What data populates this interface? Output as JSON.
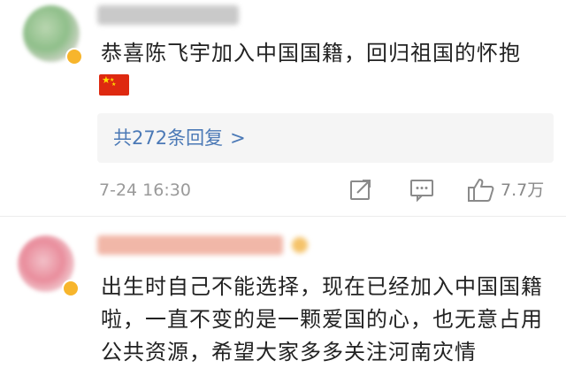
{
  "comments": [
    {
      "text": "恭喜陈飞宇加入中国国籍，回归祖国的怀抱",
      "emoji": "china-flag",
      "replies_label": "共272条回复",
      "reply_chevron": ">",
      "timestamp": "7-24 16:30",
      "likes": "7.7万"
    },
    {
      "text": "出生时自己不能选择，现在已经加入中国国籍啦，一直不变的是一颗爱国的心，也无意占用公共资源，希望大家多多关注河南灾情"
    }
  ],
  "icons": {
    "share": "share-icon",
    "comment": "comment-icon",
    "like": "thumbs-up-icon"
  },
  "colors": {
    "link": "#4b79b6",
    "meta": "#9a9a9a",
    "reply_bg": "#f5f5f5",
    "flag_red": "#de2910",
    "flag_star": "#ffde00"
  }
}
